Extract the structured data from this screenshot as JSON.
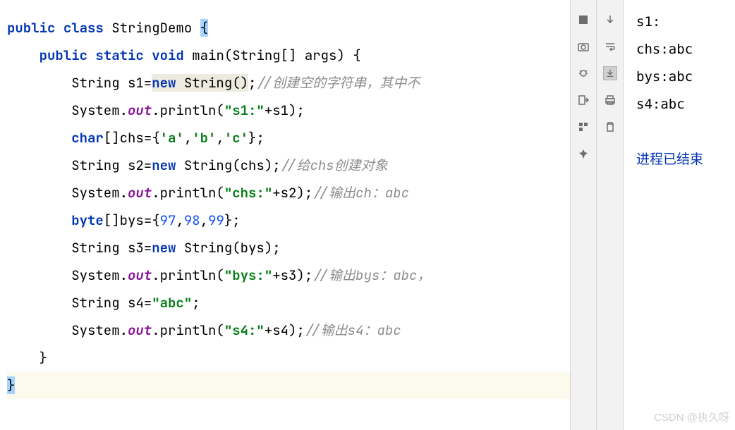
{
  "code": {
    "l1_kw1": "public",
    "l1_kw2": "class",
    "l1_name": "StringDemo",
    "l1_brace": "{",
    "l2_kw1": "public",
    "l2_kw2": "static",
    "l2_kw3": "void",
    "l2_main": "main(String[] args) {",
    "l3_pre": "String s1=",
    "l3_new": "new ",
    "l3_call": "String()",
    "l3_semi": ";",
    "l3_comment": "//创建空的字符串，其中不",
    "l4_sys": "System.",
    "l4_out": "out",
    "l4_print": ".println(",
    "l4_str": "\"s1:\"",
    "l4_end": "+s1);",
    "l5_kw": "char",
    "l5_arr": "[]chs={",
    "l5_c1": "'a'",
    "l5_c2": "'b'",
    "l5_c3": "'c'",
    "l5_end": "};",
    "l6_pre": "String s2=",
    "l6_new": "new ",
    "l6_call": "String(chs);",
    "l6_comment": "//给chs创建对象",
    "l7_sys": "System.",
    "l7_out": "out",
    "l7_print": ".println(",
    "l7_str": "\"chs:\"",
    "l7_end": "+s2);",
    "l7_comment": "//输出ch：abc",
    "l8_kw": "byte",
    "l8_arr": "[]bys={",
    "l8_n1": "97",
    "l8_n2": "98",
    "l8_n3": "99",
    "l8_end": "};",
    "l9_pre": "String s3=",
    "l9_new": "new ",
    "l9_call": "String(bys);",
    "l10_sys": "System.",
    "l10_out": "out",
    "l10_print": ".println(",
    "l10_str": "\"bys:\"",
    "l10_end": "+s3);",
    "l10_comment": "//输出bys：abc，",
    "l11_pre": "String s4=",
    "l11_str": "\"abc\"",
    "l11_end": ";",
    "l12_sys": "System.",
    "l12_out": "out",
    "l12_print": ".println(",
    "l12_str": "\"s4:\"",
    "l12_end": "+s4);",
    "l12_comment": "//输出s4：abc",
    "l13_brace": "}",
    "l14_brace": "}"
  },
  "output": {
    "l1": "s1:",
    "l2": "chs:abc",
    "l3": "bys:abc",
    "l4": "s4:abc",
    "l5": "进程已结束"
  },
  "watermark": "CSDN @执久呀"
}
